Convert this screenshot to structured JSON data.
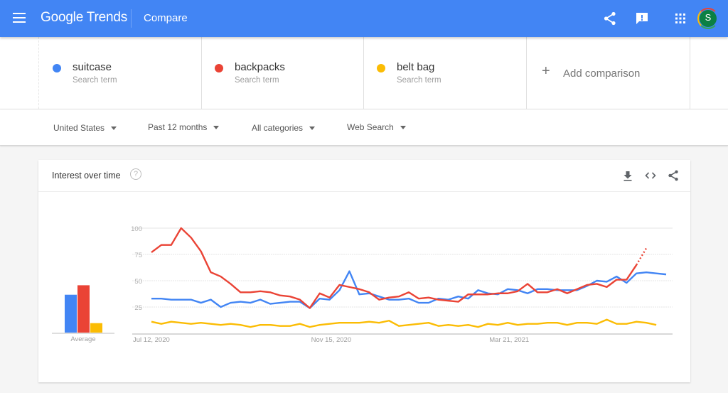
{
  "header": {
    "logo": "Google Trends",
    "title": "Compare",
    "avatar_letter": "S",
    "brand_color": "#4285f4"
  },
  "terms": [
    {
      "name": "suitcase",
      "type": "Search term",
      "color": "#4285f4"
    },
    {
      "name": "backpacks",
      "type": "Search term",
      "color": "#ea4335"
    },
    {
      "name": "belt bag",
      "type": "Search term",
      "color": "#fbbc04"
    }
  ],
  "add_comparison": "Add comparison",
  "filters": {
    "region": "United States",
    "time": "Past 12 months",
    "category": "All categories",
    "property": "Web Search"
  },
  "card": {
    "title": "Interest over time",
    "help": "?"
  },
  "chart_data": {
    "type": "line",
    "title": "Interest over time",
    "xlabel": "",
    "ylabel": "",
    "ylim": [
      0,
      100
    ],
    "yticks": [
      25,
      50,
      75,
      100
    ],
    "grid": true,
    "x_tick_labels": [
      {
        "index": 0,
        "label": "Jul 12, 2020"
      },
      {
        "index": 18,
        "label": "Nov 15, 2020"
      },
      {
        "index": 36,
        "label": "Mar 21, 2021"
      }
    ],
    "x_count": 53,
    "partial_last_point": true,
    "series": [
      {
        "name": "suitcase",
        "color": "#4285f4",
        "values": [
          33,
          33,
          32,
          32,
          32,
          29,
          32,
          25,
          29,
          30,
          29,
          32,
          28,
          29,
          30,
          30,
          24,
          33,
          32,
          41,
          59,
          37,
          38,
          35,
          32,
          32,
          33,
          29,
          29,
          33,
          32,
          35,
          33,
          41,
          38,
          37,
          42,
          41,
          38,
          42,
          42,
          41,
          41,
          41,
          45,
          50,
          49,
          54,
          48,
          57,
          58,
          57,
          56
        ]
      },
      {
        "name": "backpacks",
        "color": "#ea4335",
        "values": [
          77,
          84,
          84,
          100,
          91,
          78,
          58,
          54,
          47,
          39,
          39,
          40,
          39,
          36,
          35,
          32,
          24,
          38,
          34,
          46,
          44,
          42,
          39,
          32,
          34,
          35,
          39,
          33,
          34,
          32,
          31,
          30,
          37,
          37,
          37,
          38,
          38,
          40,
          47,
          39,
          39,
          42,
          38,
          42,
          46,
          47,
          44,
          51,
          51,
          65,
          81
        ]
      },
      {
        "name": "belt bag",
        "color": "#fbbc04",
        "values": [
          11,
          9,
          11,
          10,
          9,
          10,
          9,
          8,
          9,
          8,
          6,
          8,
          8,
          7,
          7,
          9,
          6,
          8,
          9,
          10,
          10,
          10,
          11,
          10,
          12,
          7,
          8,
          9,
          10,
          7,
          8,
          7,
          8,
          6,
          9,
          8,
          10,
          8,
          9,
          9,
          10,
          10,
          8,
          10,
          10,
          9,
          13,
          9,
          9,
          11,
          10,
          8
        ]
      }
    ],
    "average": {
      "label": "Average",
      "values": [
        {
          "name": "suitcase",
          "value": 36
        },
        {
          "name": "backpacks",
          "value": 45
        },
        {
          "name": "belt bag",
          "value": 9
        }
      ]
    }
  }
}
